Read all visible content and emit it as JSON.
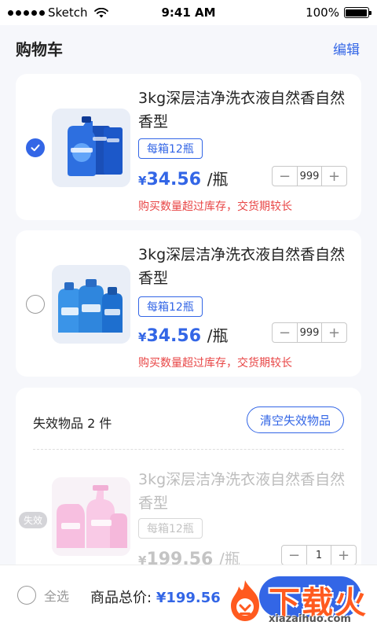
{
  "status_bar": {
    "carrier": "Sketch",
    "time": "9:41 AM",
    "battery": "100%"
  },
  "header": {
    "title": "购物车",
    "edit_label": "编辑"
  },
  "items": [
    {
      "title": "3kg深层洁净洗衣液自然香自然香型",
      "spec": "每箱12瓶",
      "currency": "¥",
      "price": "34.56",
      "unit": "/瓶",
      "quantity": "999",
      "warning": "购买数量超过库存，交货期较长",
      "selected": true
    },
    {
      "title": "3kg深层洁净洗衣液自然香自然香型",
      "spec": "每箱12瓶",
      "currency": "¥",
      "price": "34.56",
      "unit": "/瓶",
      "quantity": "999",
      "warning": "购买数量超过库存，交货期较长",
      "selected": false
    }
  ],
  "invalid": {
    "header": "失效物品 2 件",
    "clear_label": "清空失效物品",
    "item": {
      "badge": "失效",
      "title": "3kg深层洁净洗衣液自然香自然香型",
      "spec": "每箱12瓶",
      "currency": "¥",
      "price": "199.56",
      "unit": "/瓶",
      "quantity": "1"
    }
  },
  "bottom": {
    "select_all_label": "全选",
    "total_label": "商品总价:",
    "total_amount": "¥199.56"
  },
  "stepper": {
    "minus": "−",
    "plus": "+"
  },
  "watermark": {
    "text": "下载火",
    "url": "xiazaihuo.com"
  },
  "colors": {
    "accent": "#3366e6",
    "warning": "#e84545",
    "background": "#f6f7fb"
  },
  "icons": [
    "wifi-icon",
    "battery-icon",
    "check-icon",
    "fire-icon"
  ]
}
